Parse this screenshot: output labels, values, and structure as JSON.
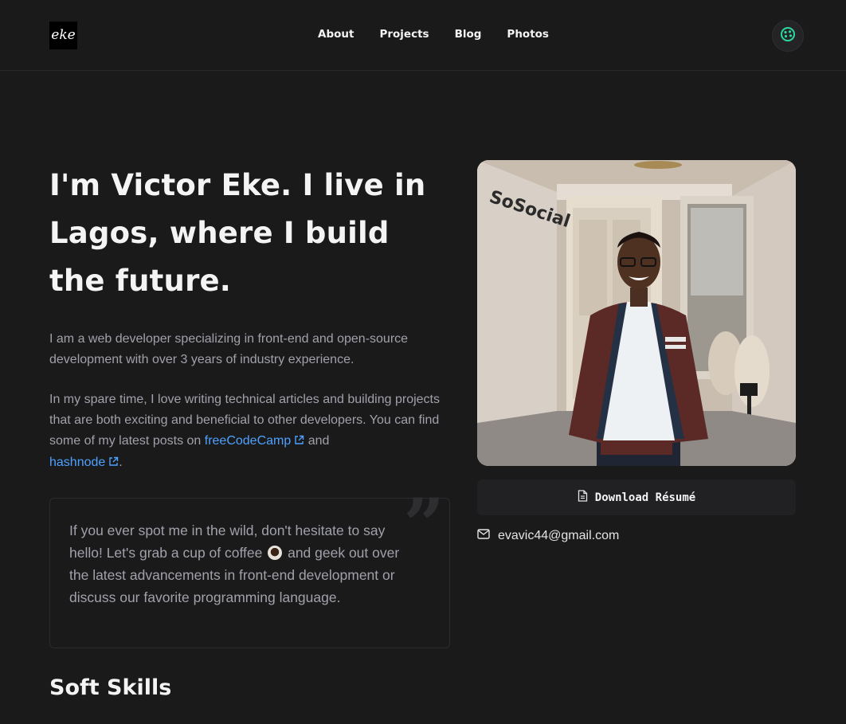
{
  "header": {
    "logo_text": "eke",
    "nav": [
      {
        "label": "About"
      },
      {
        "label": "Projects"
      },
      {
        "label": "Blog"
      },
      {
        "label": "Photos"
      }
    ],
    "theme_icon": "palette-icon"
  },
  "hero": {
    "title": "I'm Victor Eke. I live in Lagos, where I build the future.",
    "intro": "I am a web developer specializing in front-end and open-source development with over 3 years of industry experience.",
    "spare_time_pre": "In my spare time, I love writing technical articles and building projects that are both exciting and beneficial to other developers. You can find some of my latest posts on ",
    "link_fcc": "freeCodeCamp",
    "and_text": " and",
    "link_hashnode": "hashnode",
    "period": ".",
    "external_icon": "external-link-icon"
  },
  "quote": {
    "part1": "If you ever spot me in the wild, don't hesitate to say hello! Let's grab a cup of coffee ",
    "part2": " and geek out over the latest advancements in front-end development or discuss our favorite programming language."
  },
  "sidebar": {
    "photo_sign_text": "SoSocial",
    "resume_label": "Download Résumé",
    "resume_icon": "file-icon",
    "email": "evavic44@gmail.com",
    "email_icon": "mail-icon"
  },
  "soft_skills": {
    "title": "Soft Skills"
  },
  "colors": {
    "background": "#1a1a1b",
    "link": "#4ea1ff",
    "theme_accent": "#2bd99e"
  }
}
